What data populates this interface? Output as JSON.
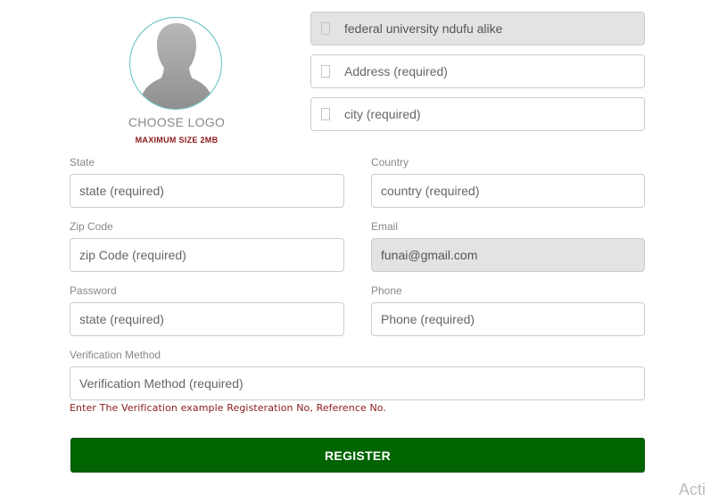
{
  "logo": {
    "choose_label": "CHOOSE LOGO",
    "max_size_label": "MAXIMUM SIZE 2MB",
    "icon": "avatar-placeholder-icon"
  },
  "institution_name": {
    "value": "federal university ndufu alike",
    "placeholder": "",
    "icon": "building-icon"
  },
  "address": {
    "value": "",
    "placeholder": "Address (required)",
    "icon": "building-icon"
  },
  "city": {
    "value": "",
    "placeholder": "city (required)",
    "icon": "building-icon"
  },
  "state": {
    "label": "State",
    "value": "",
    "placeholder": "state (required)"
  },
  "country": {
    "label": "Country",
    "value": "",
    "placeholder": "country (required)"
  },
  "zip": {
    "label": "Zip Code",
    "value": "",
    "placeholder": "zip Code (required)"
  },
  "email": {
    "label": "Email",
    "value": "funai@gmail.com",
    "placeholder": ""
  },
  "password": {
    "label": "Password",
    "value": "",
    "placeholder": "state (required)"
  },
  "phone": {
    "label": "Phone",
    "value": "",
    "placeholder": "Phone (required)"
  },
  "verification": {
    "label": "Verification Method",
    "value": "",
    "placeholder": "Verification Method (required)",
    "hint": "Enter The Verification example Registeration No, Reference No."
  },
  "register_button": {
    "label": "REGISTER"
  },
  "watermark": "Acti",
  "colors": {
    "primary_button": "#006400",
    "hint_text": "#8b1a1a",
    "readonly_bg": "#e3e3e3",
    "logo_border": "#5fbfbf"
  }
}
